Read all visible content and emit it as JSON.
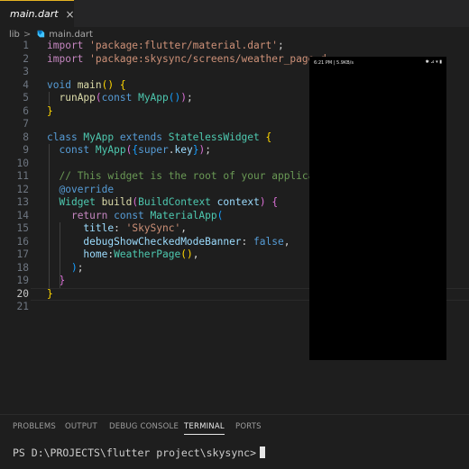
{
  "tab": {
    "filename": "main.dart",
    "close": "×"
  },
  "breadcrumb": {
    "folder": "lib",
    "separator": ">",
    "file": "main.dart"
  },
  "editor": {
    "active_line": 20,
    "lines": [
      {
        "n": "1",
        "tokens": [
          [
            "kw",
            "import "
          ],
          [
            "str",
            "'package:flutter/material.dart'"
          ],
          [
            "plain",
            ";"
          ]
        ]
      },
      {
        "n": "2",
        "tokens": [
          [
            "kw",
            "import "
          ],
          [
            "str",
            "'package:skysync/screens/weather_page.d"
          ]
        ]
      },
      {
        "n": "3",
        "tokens": []
      },
      {
        "n": "4",
        "tokens": [
          [
            "kb",
            "void "
          ],
          [
            "fn",
            "main"
          ],
          [
            "br1",
            "()"
          ],
          [
            "plain",
            " "
          ],
          [
            "br1",
            "{"
          ]
        ]
      },
      {
        "n": "5",
        "tokens": [
          [
            "plain",
            "  "
          ],
          [
            "fn",
            "runApp"
          ],
          [
            "br2",
            "("
          ],
          [
            "kb",
            "const "
          ],
          [
            "cls",
            "MyApp"
          ],
          [
            "br3",
            "()"
          ],
          [
            "br2",
            ")"
          ],
          [
            "plain",
            ";"
          ]
        ]
      },
      {
        "n": "6",
        "tokens": [
          [
            "br1",
            "}"
          ]
        ]
      },
      {
        "n": "7",
        "tokens": []
      },
      {
        "n": "8",
        "tokens": [
          [
            "kb",
            "class "
          ],
          [
            "cls",
            "MyApp"
          ],
          [
            "kb",
            " extends "
          ],
          [
            "cls",
            "StatelessWidget"
          ],
          [
            "plain",
            " "
          ],
          [
            "br1",
            "{"
          ]
        ]
      },
      {
        "n": "9",
        "tokens": [
          [
            "plain",
            "  "
          ],
          [
            "kb",
            "const "
          ],
          [
            "cls",
            "MyApp"
          ],
          [
            "br2",
            "("
          ],
          [
            "br3",
            "{"
          ],
          [
            "kb",
            "super"
          ],
          [
            "plain",
            "."
          ],
          [
            "var",
            "key"
          ],
          [
            "br3",
            "}"
          ],
          [
            "br2",
            ")"
          ],
          [
            "plain",
            ";"
          ]
        ]
      },
      {
        "n": "10",
        "tokens": []
      },
      {
        "n": "11",
        "tokens": [
          [
            "plain",
            "  "
          ],
          [
            "cmt",
            "// This widget is the root of your applicati"
          ]
        ]
      },
      {
        "n": "12",
        "tokens": [
          [
            "plain",
            "  "
          ],
          [
            "kb",
            "@override"
          ]
        ]
      },
      {
        "n": "13",
        "tokens": [
          [
            "plain",
            "  "
          ],
          [
            "cls",
            "Widget"
          ],
          [
            "plain",
            " "
          ],
          [
            "fn",
            "build"
          ],
          [
            "br2",
            "("
          ],
          [
            "cls",
            "BuildContext"
          ],
          [
            "plain",
            " "
          ],
          [
            "var",
            "context"
          ],
          [
            "br2",
            ")"
          ],
          [
            "plain",
            " "
          ],
          [
            "br2",
            "{"
          ]
        ]
      },
      {
        "n": "14",
        "tokens": [
          [
            "plain",
            "    "
          ],
          [
            "kw",
            "return "
          ],
          [
            "kb",
            "const "
          ],
          [
            "cls",
            "MaterialApp"
          ],
          [
            "br3",
            "("
          ]
        ]
      },
      {
        "n": "15",
        "tokens": [
          [
            "plain",
            "      "
          ],
          [
            "var",
            "title"
          ],
          [
            "plain",
            ": "
          ],
          [
            "str",
            "'SkySync'"
          ],
          [
            "plain",
            ","
          ]
        ]
      },
      {
        "n": "16",
        "tokens": [
          [
            "plain",
            "      "
          ],
          [
            "var",
            "debugShowCheckedModeBanner"
          ],
          [
            "plain",
            ": "
          ],
          [
            "kb",
            "false"
          ],
          [
            "plain",
            ","
          ]
        ]
      },
      {
        "n": "17",
        "tokens": [
          [
            "plain",
            "      "
          ],
          [
            "var",
            "home"
          ],
          [
            "plain",
            ":"
          ],
          [
            "cls",
            "WeatherPage"
          ],
          [
            "br1",
            "()"
          ],
          [
            "plain",
            ","
          ]
        ]
      },
      {
        "n": "18",
        "tokens": [
          [
            "plain",
            "    "
          ],
          [
            "br3",
            ")"
          ],
          [
            "plain",
            ";"
          ]
        ]
      },
      {
        "n": "19",
        "tokens": [
          [
            "plain",
            "  "
          ],
          [
            "br2",
            "}"
          ]
        ]
      },
      {
        "n": "20",
        "tokens": [
          [
            "br1",
            "}"
          ]
        ]
      },
      {
        "n": "21",
        "tokens": []
      }
    ]
  },
  "emulator": {
    "status_time": "6:21 PM | 5.9KB/s",
    "status_icons": "✱ ⊿ ▾ ▮"
  },
  "panel": {
    "tabs": [
      {
        "label": "PROBLEMS",
        "active": false
      },
      {
        "label": "OUTPUT",
        "active": false
      },
      {
        "label": "DEBUG CONSOLE",
        "active": false
      },
      {
        "label": "TERMINAL",
        "active": true
      },
      {
        "label": "PORTS",
        "active": false
      }
    ],
    "terminal_prompt": "PS D:\\PROJECTS\\flutter project\\skysync>"
  },
  "colors": {
    "accent": "#e6b422",
    "background": "#1e1e1e"
  }
}
